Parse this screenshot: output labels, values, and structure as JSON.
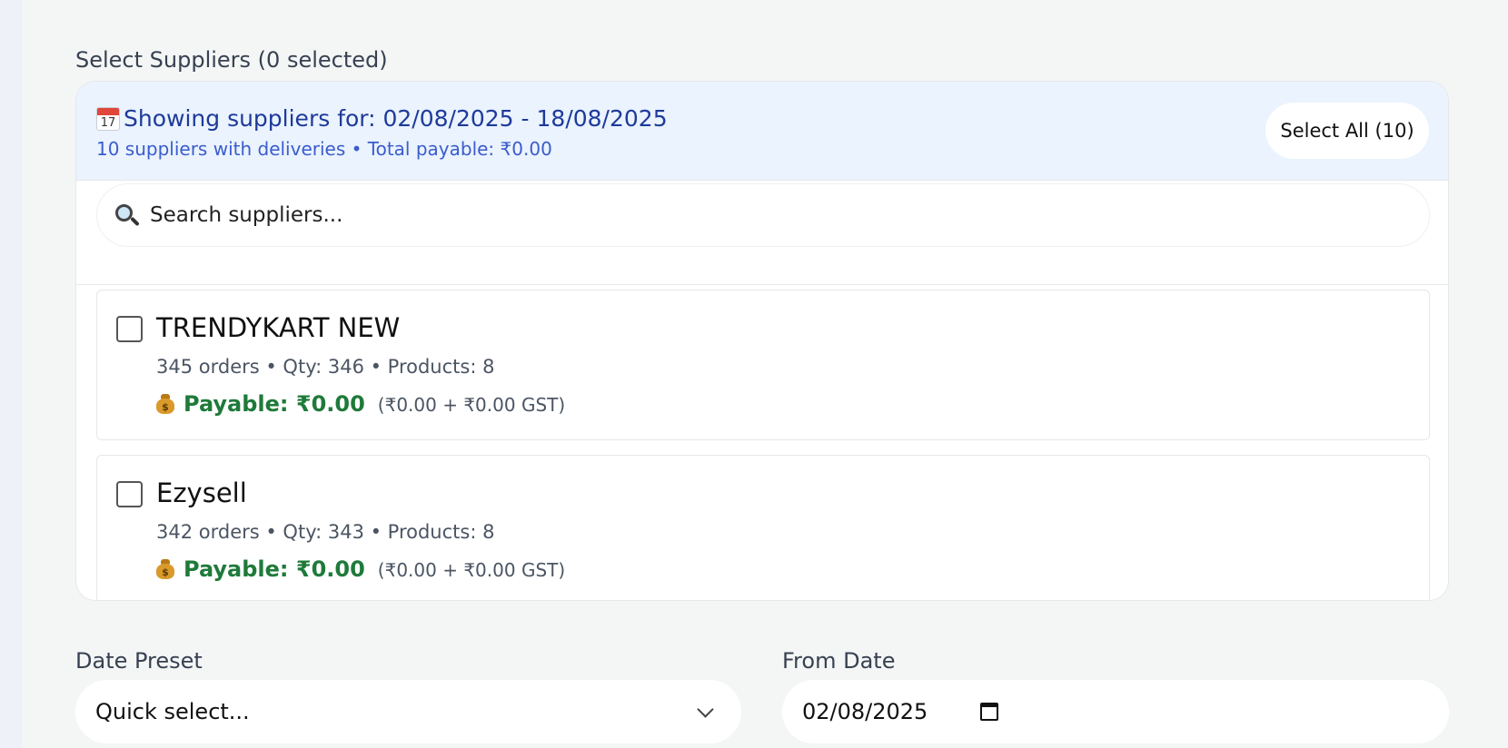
{
  "suppliers_section": {
    "label": "Select Suppliers (0 selected)",
    "header": {
      "calendar_day": "17",
      "title": "Showing suppliers for: 02/08/2025 - 18/08/2025",
      "subtitle": "10 suppliers with deliveries • Total payable: ₹0.00",
      "select_all_label": "Select All (10)"
    },
    "search": {
      "placeholder": "Search suppliers..."
    },
    "suppliers": [
      {
        "name": "TRENDYKART NEW",
        "meta": "345 orders • Qty: 346 • Products: 8",
        "payable": "Payable: ₹0.00",
        "payable_detail": "(₹0.00 + ₹0.00 GST)",
        "checked": false
      },
      {
        "name": "Ezysell",
        "meta": "342 orders • Qty: 343 • Products: 8",
        "payable": "Payable: ₹0.00",
        "payable_detail": "(₹0.00 + ₹0.00 GST)",
        "checked": false
      }
    ]
  },
  "date_preset": {
    "label": "Date Preset",
    "value": "Quick select..."
  },
  "from_date": {
    "label": "From Date",
    "value": "02/08/2025"
  },
  "colors": {
    "header_bg": "#eaf3fe",
    "title_blue": "#1e3a9a",
    "subtitle_blue": "#3b5ccc",
    "payable_green": "#1f7a3a"
  }
}
